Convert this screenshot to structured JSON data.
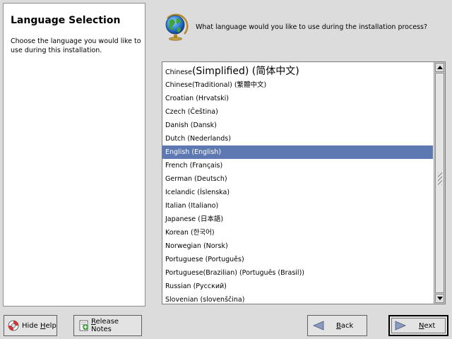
{
  "help": {
    "title": "Language Selection",
    "text": "Choose the language you would like to use during this installation."
  },
  "header": {
    "question": "What language would you like to use during the installation process?",
    "icon": "globe-icon"
  },
  "languages": [
    {
      "label": "Chinese(Simplified) (简体中文)",
      "selected": false,
      "big": true
    },
    {
      "label": "Chinese(Traditional) (繁體中文)",
      "selected": false
    },
    {
      "label": "Croatian (Hrvatski)",
      "selected": false
    },
    {
      "label": "Czech (Čeština)",
      "selected": false
    },
    {
      "label": "Danish (Dansk)",
      "selected": false
    },
    {
      "label": "Dutch (Nederlands)",
      "selected": false
    },
    {
      "label": "English (English)",
      "selected": true
    },
    {
      "label": "French (Français)",
      "selected": false
    },
    {
      "label": "German (Deutsch)",
      "selected": false
    },
    {
      "label": "Icelandic (Íslenska)",
      "selected": false
    },
    {
      "label": "Italian (Italiano)",
      "selected": false
    },
    {
      "label": "Japanese (日本語)",
      "selected": false
    },
    {
      "label": "Korean (한국어)",
      "selected": false
    },
    {
      "label": "Norwegian (Norsk)",
      "selected": false
    },
    {
      "label": "Portuguese (Português)",
      "selected": false
    },
    {
      "label": "Portuguese(Brazilian) (Português (Brasil))",
      "selected": false
    },
    {
      "label": "Russian (Русский)",
      "selected": false
    },
    {
      "label": "Slovenian (slovenščina)",
      "selected": false
    }
  ],
  "buttons": {
    "hide_help": {
      "pre": "Hide ",
      "accel": "H",
      "post": "elp"
    },
    "release_notes": {
      "pre": "",
      "accel": "R",
      "post": "elease Notes"
    },
    "back": {
      "pre": "",
      "accel": "B",
      "post": "ack"
    },
    "next": {
      "pre": "",
      "accel": "N",
      "post": "ext"
    }
  },
  "colors": {
    "selection": "#5e79b1",
    "background": "#dcdcdc"
  }
}
